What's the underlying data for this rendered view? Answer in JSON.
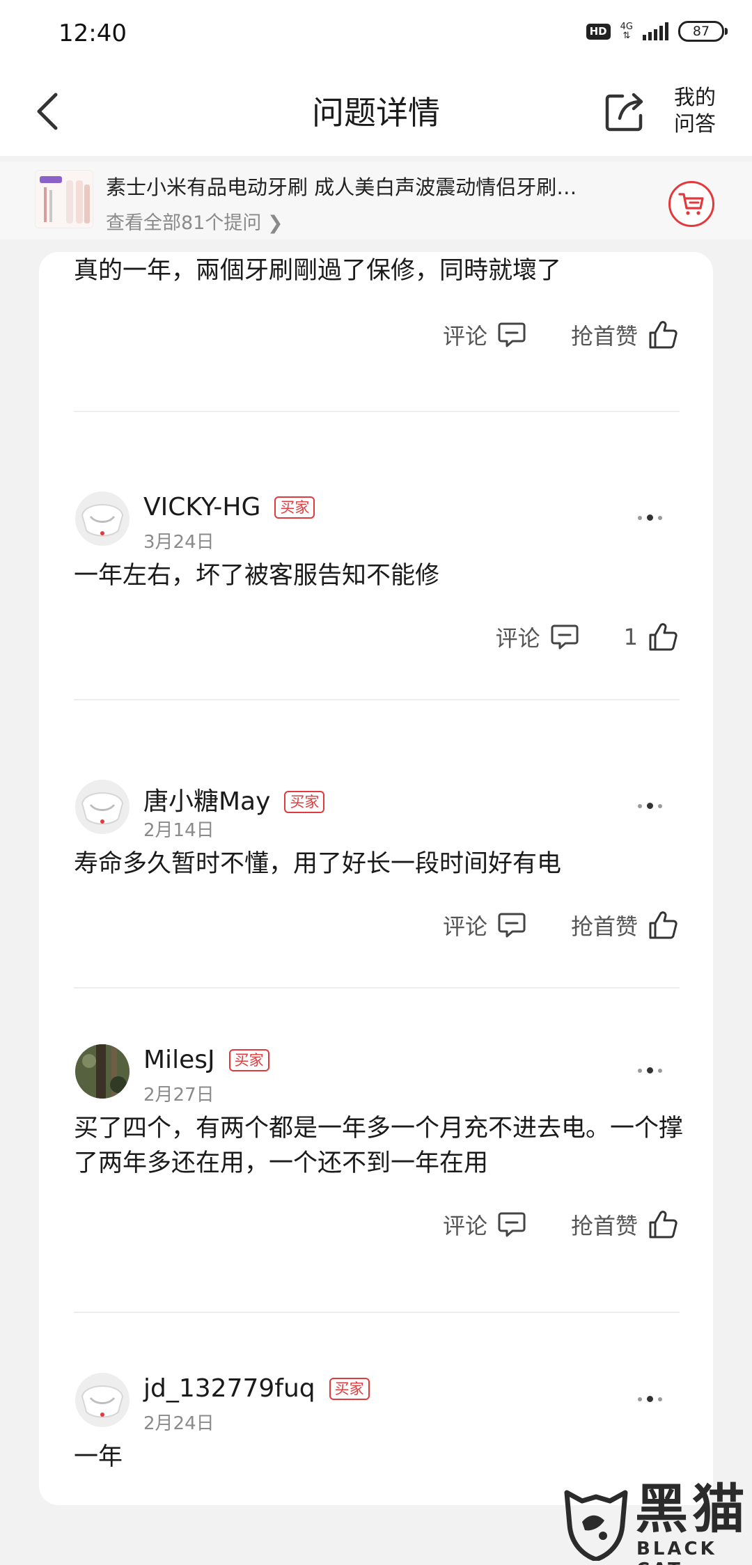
{
  "status_bar": {
    "time": "12:40",
    "hd": "HD",
    "network": "4G",
    "battery": "87"
  },
  "nav": {
    "title": "问题详情",
    "my_qa": "我的问答"
  },
  "product": {
    "name": "素士小米有品电动牙刷 成人美白声波震动情侣牙刷…",
    "view_all": "查看全部81个提问 ❯"
  },
  "labels": {
    "comment": "评论",
    "first_like": "抢首赞",
    "buyer": "买家"
  },
  "answers": [
    {
      "text": "真的一年，兩個牙刷剛過了保修，同時就壞了",
      "like_label": "抢首赞"
    },
    {
      "user": "VICKY-HG",
      "date": "3月24日",
      "text": "一年左右，坏了被客服告知不能修",
      "like_label": "1"
    },
    {
      "user": "唐小糖May",
      "date": "2月14日",
      "text": "寿命多久暂时不懂，用了好长一段时间好有电",
      "like_label": "抢首赞"
    },
    {
      "user": "MilesJ",
      "date": "2月27日",
      "text": "买了四个，有两个都是一年多一个月充不进去电。一个撑了两年多还在用，一个还不到一年在用",
      "like_label": "抢首赞"
    },
    {
      "user": "jd_132779fuq",
      "date": "2月24日",
      "text": "一年"
    }
  ],
  "watermark": {
    "cn": "黑猫",
    "en": "BLACK CAT"
  },
  "icons": {
    "back": "back-arrow-icon",
    "share": "share-icon",
    "cart": "cart-icon",
    "comment": "comment-icon",
    "like": "thumbs-up-icon",
    "more": "more-dots-icon"
  },
  "colors": {
    "accent": "#e4393c",
    "background": "#f2f2f2",
    "card": "#ffffff"
  }
}
